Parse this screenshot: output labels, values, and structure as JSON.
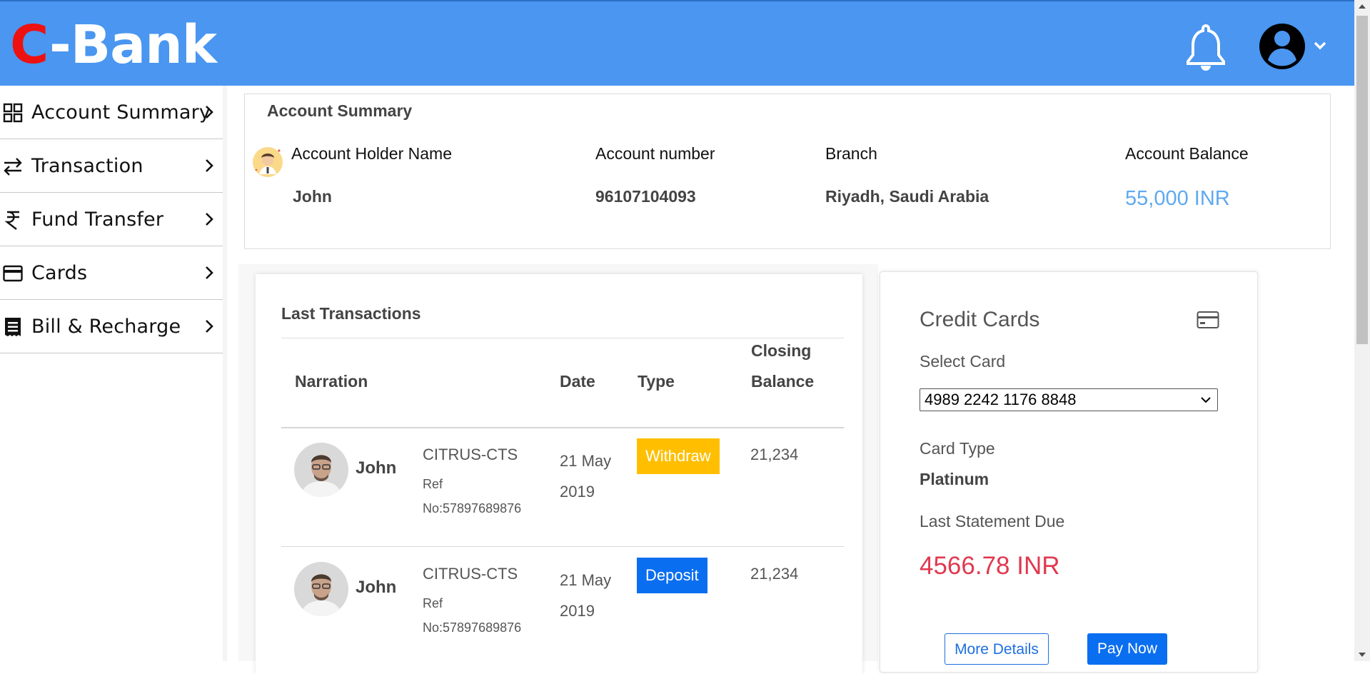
{
  "header": {
    "logo_c": "C",
    "logo_rest": "-Bank"
  },
  "sidebar": {
    "items": [
      {
        "label": "Account Summary",
        "icon": "grid-icon"
      },
      {
        "label": "Transaction",
        "icon": "transfer-arrows-icon"
      },
      {
        "label": "Fund Transfer",
        "icon": "rupee-icon"
      },
      {
        "label": "Cards",
        "icon": "card-icon"
      },
      {
        "label": "Bill & Recharge",
        "icon": "receipt-icon"
      }
    ]
  },
  "summary": {
    "title": "Account Summary",
    "headers": {
      "holder": "Account Holder Name",
      "number": "Account number",
      "branch": "Branch",
      "balance": "Account Balance"
    },
    "values": {
      "holder": "John",
      "number": "96107104093",
      "branch": "Riyadh, Saudi Arabia",
      "balance": "55,000 INR"
    }
  },
  "transactions": {
    "title": "Last Transactions",
    "columns": {
      "narration": "Narration",
      "date": "Date",
      "type": "Type",
      "closing1": "Closing",
      "closing2": "Balance"
    },
    "rows": [
      {
        "name": "John",
        "narration": "CITRUS-CTS",
        "ref1": "Ref",
        "ref2": "No:57897689876",
        "date": "21 May 2019",
        "type": "Withdraw",
        "type_color": "#ffbf00",
        "closing": "21,234"
      },
      {
        "name": "John",
        "narration": "CITRUS-CTS",
        "ref1": "Ref",
        "ref2": "No:57897689876",
        "date": "21 May 2019",
        "type": "Deposit",
        "type_color": "#0a6ef0",
        "closing": "21,234"
      }
    ]
  },
  "credit": {
    "title": "Credit Cards",
    "select_label": "Select Card",
    "selected_card": "4989 2242 1176 8848",
    "card_type_label": "Card Type",
    "card_type": "Platinum",
    "due_label": "Last Statement Due",
    "due_amount": "4566.78 INR",
    "more_label": "More Details",
    "pay_label": "Pay Now"
  },
  "colors": {
    "header_bg": "#4a96f0",
    "logo_accent": "#ee1111",
    "balance": "#5ea9ef",
    "due": "#e0394f",
    "withdraw": "#ffbf00",
    "deposit": "#0a6ef0"
  }
}
